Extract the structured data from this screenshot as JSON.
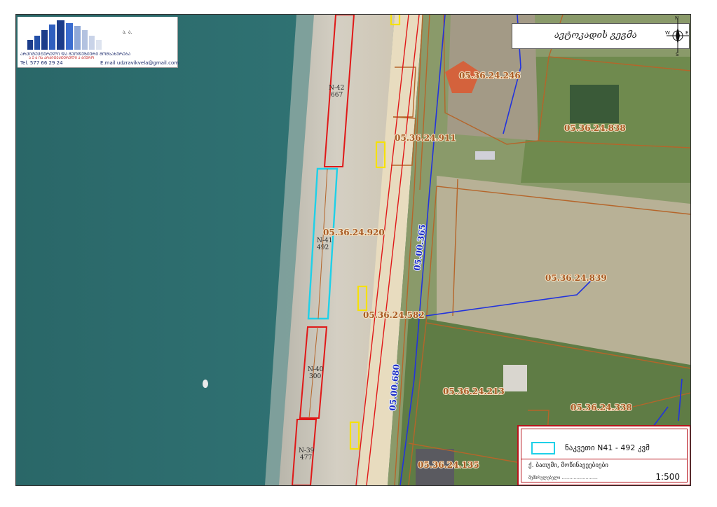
{
  "logo": {
    "small_text": "ა. ა.",
    "line1": "ᲐᲠᲥᲘᲢᲔᲥᲢᲣᲠᲣᲚᲘ ᲓᲐ ᲒᲔᲝᲓᲔᲖᲘᲣᲠᲘ ᲛᲝᲛᲡᲐᲮᲣᲠᲔᲑᲐ",
    "line2": "Ა Ე Ბ ᲘᲡ ᲐᲠᲥᲘᲢᲔᲥᲢᲣᲠᲣᲚᲘ Ა ᲑᲘᲣᲠᲝ",
    "tel_label": "Tel.",
    "tel_value": "577 66 29 24",
    "email_label": "E.mail",
    "email_value": "udzravikvela@gmail.com"
  },
  "north_box": {
    "signature_text": "ავტოკადის გეგმა",
    "compass": {
      "n": "N",
      "s": "S",
      "e": "E",
      "w": "W"
    }
  },
  "parcel_labels": [
    "05.36.24.246",
    "05.36.24.911",
    "05.36.24.838",
    "05.36.24.920",
    "05.36.24.839",
    "05.36.24.582",
    "05.36.24.213",
    "05.36.24.338",
    "05.36.24.135"
  ],
  "road_labels": [
    "05.00.365",
    "05.00.680"
  ],
  "plots": [
    {
      "id": "N-42",
      "area": "667",
      "color": "red"
    },
    {
      "id": "N-41",
      "area": "492",
      "color": "cyan"
    },
    {
      "id": "N-40",
      "area": "300",
      "color": "red"
    },
    {
      "id": "N-39",
      "area": "477",
      "color": "red"
    }
  ],
  "legend": {
    "swatch_color": "#1fd0e8",
    "text": "ნაკვეთი N41 - 492 კვმ",
    "address": "ქ. ბათუმი, მოწინავეებიები",
    "signature": "შემსრულებელი ...........................",
    "scale": "1:500"
  },
  "colors": {
    "sea": "#2f6b6c",
    "parcel_line": "#b5652a",
    "plot_red": "#e01818",
    "plot_cyan": "#1fd0e8",
    "road_blue": "#2233dd",
    "marker_yellow": "#f5e10a"
  }
}
